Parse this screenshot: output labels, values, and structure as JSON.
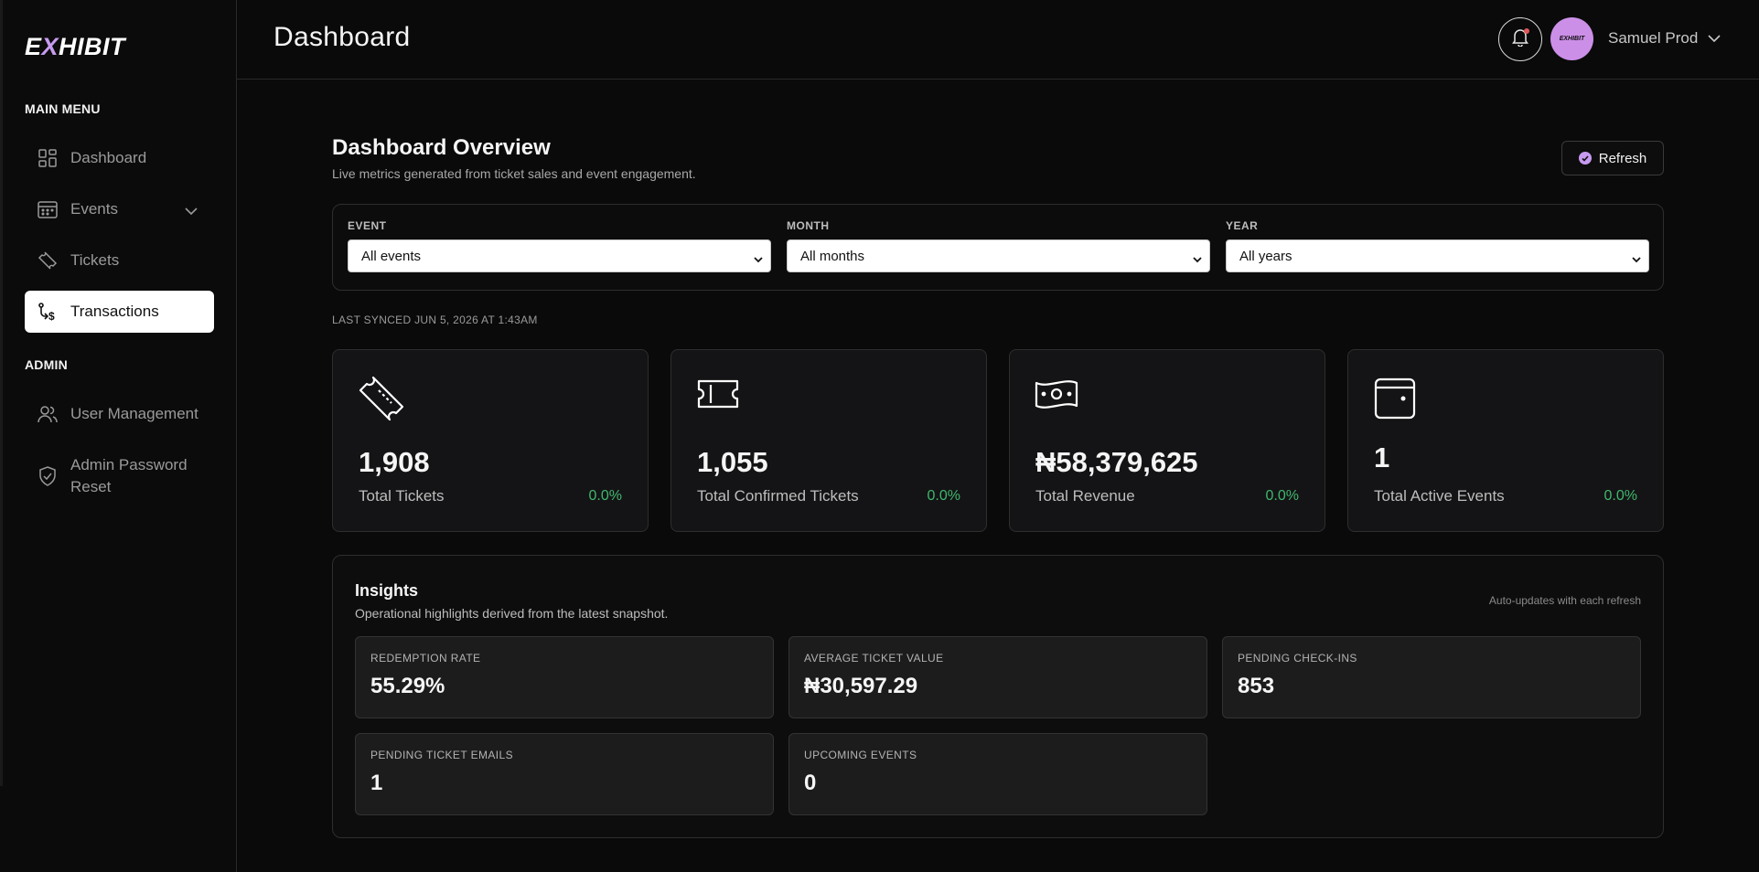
{
  "brand": {
    "logo_text_1": "E",
    "logo_text_x": "X",
    "logo_text_2": "HIBIT"
  },
  "sidebar": {
    "main_heading": "MAIN MENU",
    "admin_heading": "ADMIN",
    "items": [
      {
        "label": "Dashboard",
        "icon": "grid-icon"
      },
      {
        "label": "Events",
        "icon": "calendar-icon"
      },
      {
        "label": "Tickets",
        "icon": "ticket-icon"
      },
      {
        "label": "Transactions",
        "icon": "transactions-icon",
        "active": true
      }
    ],
    "admin_items": [
      {
        "label": "User Management",
        "icon": "users-icon"
      },
      {
        "label": "Admin Password Reset",
        "icon": "shield-check-icon"
      }
    ]
  },
  "header": {
    "title": "Dashboard",
    "user_name": "Samuel Prod",
    "avatar_text": "EXHIBIT"
  },
  "overview": {
    "title": "Dashboard Overview",
    "subtitle": "Live metrics generated from ticket sales and event engagement.",
    "refresh_label": "Refresh"
  },
  "filters": [
    {
      "label": "EVENT",
      "value": "All events"
    },
    {
      "label": "MONTH",
      "value": "All months"
    },
    {
      "label": "YEAR",
      "value": "All years"
    }
  ],
  "synced_text": "LAST SYNCED JUN 5, 2026 AT 1:43AM",
  "stats": [
    {
      "value": "1,908",
      "label": "Total Tickets",
      "change": "0.0%",
      "icon": "ticket-tilted-icon"
    },
    {
      "value": "1,055",
      "label": "Total Confirmed Tickets",
      "change": "0.0%",
      "icon": "ticket-stub-icon"
    },
    {
      "value": "₦58,379,625",
      "label": "Total Revenue",
      "change": "0.0%",
      "icon": "banknote-icon"
    },
    {
      "value": "1",
      "label": "Total Active Events",
      "change": "0.0%",
      "icon": "calendar-card-icon"
    }
  ],
  "insights": {
    "title": "Insights",
    "subtitle": "Operational highlights derived from the latest snapshot.",
    "note": "Auto-updates with each refresh",
    "metrics": [
      {
        "label": "REDEMPTION RATE",
        "value": "55.29%"
      },
      {
        "label": "AVERAGE TICKET VALUE",
        "value": "₦30,597.29"
      },
      {
        "label": "PENDING CHECK-INS",
        "value": "853"
      },
      {
        "label": "PENDING TICKET EMAILS",
        "value": "1"
      },
      {
        "label": "UPCOMING EVENTS",
        "value": "0"
      }
    ]
  },
  "colors": {
    "accent": "#c79bf0",
    "positive": "#3fb86d",
    "background": "#0a0a0a"
  }
}
